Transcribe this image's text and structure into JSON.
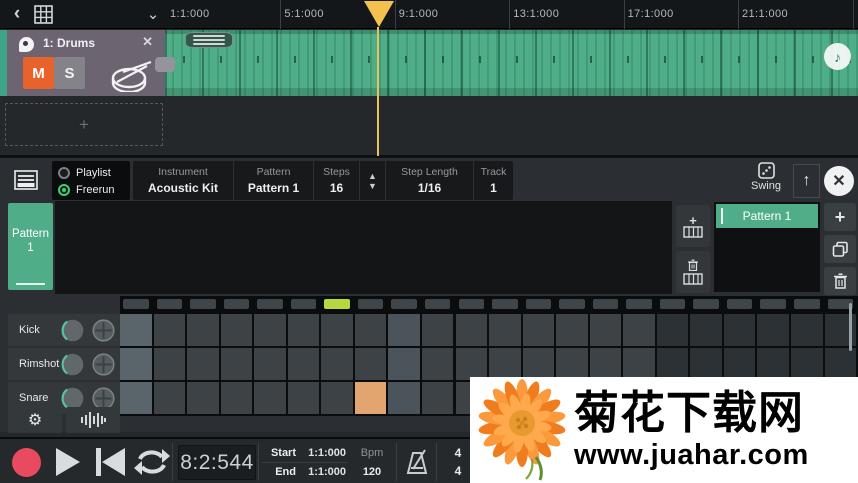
{
  "icons": {
    "back": "‹",
    "collapse": "⌄",
    "track_close": "✕",
    "seq_close": "✕",
    "add_plus": "+",
    "up_arrow": "↑",
    "gear": "⚙",
    "note": "♪",
    "stepper_up": "▲",
    "stepper_down": "▼"
  },
  "top_bar": {
    "timeline_labels": [
      "1:1:000",
      "5:1:000",
      "9:1:000",
      "13:1:000",
      "17:1:000",
      "21:1:000"
    ]
  },
  "track": {
    "name": "1: Drums",
    "mute": "M",
    "solo": "S"
  },
  "sequencer": {
    "modes": {
      "playlist": "Playlist",
      "freerun": "Freerun",
      "selected": "Freerun"
    },
    "fields": [
      {
        "label": "Instrument",
        "value": "Acoustic Kit"
      },
      {
        "label": "Pattern",
        "value": "Pattern 1"
      },
      {
        "label": "Steps",
        "value": "16"
      },
      {
        "label": "Step Length",
        "value": "1/16"
      },
      {
        "label": "Track",
        "value": "1"
      }
    ],
    "swing_label": "Swing",
    "pattern_tab": "Pattern 1",
    "patterns": [
      {
        "label": "Pattern 1",
        "selected": true
      }
    ],
    "grid": {
      "rows": [
        "Kick",
        "Rimshot",
        "Snare"
      ],
      "steps": 16,
      "visible_columns": 22,
      "playhead_step": 7,
      "active_cells": [
        {
          "row": "Snare",
          "step": 8
        }
      ]
    }
  },
  "transport": {
    "time": "8:2:544",
    "start_label": "Start",
    "start_value": "1:1:000",
    "end_label": "End",
    "end_value": "1:1:000",
    "bpm_label": "Bpm",
    "bpm_value": "120",
    "time_sig_numerator": "4",
    "time_sig_denominator": "4"
  },
  "watermark": {
    "site_name": "菊花下载网",
    "site_url": "www.juahar.com"
  },
  "colors": {
    "clip_green": "#4fae88",
    "pattern_green": "#4fae88",
    "playhead_yellow": "#f2c14e",
    "step_playhead_green": "#b5d83e",
    "active_cell_orange": "#e2a570",
    "mute_orange": "#e8632b",
    "record_red": "#e84b5f",
    "grid": {
      "cell_normal": "#3c4246",
      "cell_beat1": "#5a646b",
      "cell_beat3": "#4b545a",
      "cell_outside": "#2c3135",
      "pill_normal": "#3f464a"
    }
  }
}
